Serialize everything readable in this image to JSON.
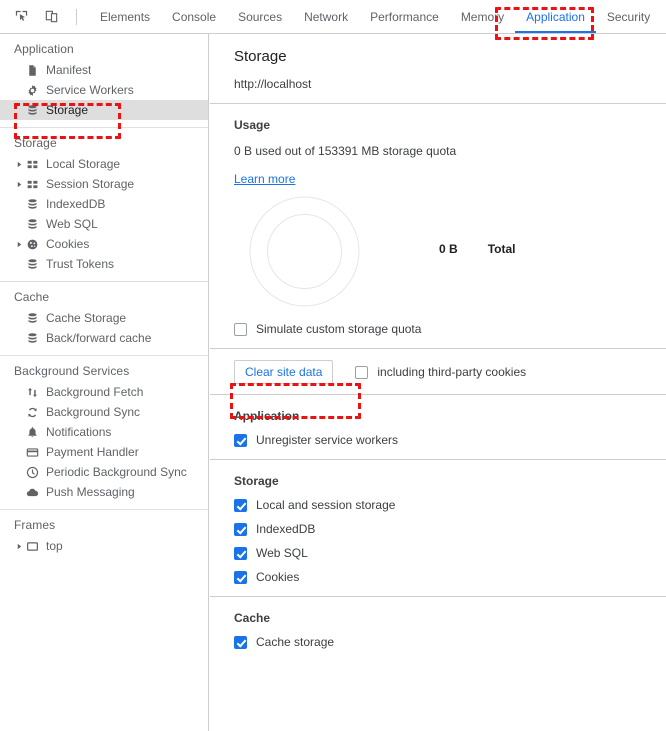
{
  "toolbar": {
    "inspect_icon": "inspect-cursor-icon",
    "device_icon": "device-toolbar-icon"
  },
  "tabs": [
    {
      "label": "Elements",
      "active": false
    },
    {
      "label": "Console",
      "active": false
    },
    {
      "label": "Sources",
      "active": false
    },
    {
      "label": "Network",
      "active": false
    },
    {
      "label": "Performance",
      "active": false
    },
    {
      "label": "Memory",
      "active": false
    },
    {
      "label": "Application",
      "active": true
    },
    {
      "label": "Security",
      "active": false
    }
  ],
  "sidebar": {
    "groups": [
      {
        "title": "Application",
        "items": [
          {
            "label": "Manifest",
            "icon": "document-icon",
            "arrow": false,
            "selected": false
          },
          {
            "label": "Service Workers",
            "icon": "gear-icon",
            "arrow": false,
            "selected": false
          },
          {
            "label": "Storage",
            "icon": "database-icon",
            "arrow": false,
            "selected": true
          }
        ]
      },
      {
        "title": "Storage",
        "items": [
          {
            "label": "Local Storage",
            "icon": "table-icon",
            "arrow": true,
            "selected": false
          },
          {
            "label": "Session Storage",
            "icon": "table-icon",
            "arrow": true,
            "selected": false
          },
          {
            "label": "IndexedDB",
            "icon": "database-icon",
            "arrow": false,
            "selected": false
          },
          {
            "label": "Web SQL",
            "icon": "database-icon",
            "arrow": false,
            "selected": false
          },
          {
            "label": "Cookies",
            "icon": "cookie-icon",
            "arrow": true,
            "selected": false
          },
          {
            "label": "Trust Tokens",
            "icon": "database-icon",
            "arrow": false,
            "selected": false
          }
        ]
      },
      {
        "title": "Cache",
        "items": [
          {
            "label": "Cache Storage",
            "icon": "database-icon",
            "arrow": false,
            "selected": false
          },
          {
            "label": "Back/forward cache",
            "icon": "database-icon",
            "arrow": false,
            "selected": false
          }
        ]
      },
      {
        "title": "Background Services",
        "items": [
          {
            "label": "Background Fetch",
            "icon": "arrows-updown-icon",
            "arrow": false,
            "selected": false
          },
          {
            "label": "Background Sync",
            "icon": "sync-icon",
            "arrow": false,
            "selected": false
          },
          {
            "label": "Notifications",
            "icon": "bell-icon",
            "arrow": false,
            "selected": false
          },
          {
            "label": "Payment Handler",
            "icon": "credit-card-icon",
            "arrow": false,
            "selected": false
          },
          {
            "label": "Periodic Background Sync",
            "icon": "clock-icon",
            "arrow": false,
            "selected": false
          },
          {
            "label": "Push Messaging",
            "icon": "cloud-icon",
            "arrow": false,
            "selected": false
          }
        ]
      },
      {
        "title": "Frames",
        "items": [
          {
            "label": "top",
            "icon": "frame-icon",
            "arrow": true,
            "selected": false
          }
        ]
      }
    ]
  },
  "panel": {
    "title": "Storage",
    "origin": "http://localhost",
    "usage": {
      "heading": "Usage",
      "text": "0 B used out of 153391 MB storage quota",
      "learn_more": "Learn more",
      "simulate_quota_label": "Simulate custom storage quota",
      "simulate_quota_checked": false
    },
    "clear": {
      "button_label": "Clear site data",
      "third_party_label": "including third-party cookies",
      "third_party_checked": false
    },
    "groups": [
      {
        "title": "Application",
        "items": [
          {
            "label": "Unregister service workers",
            "checked": true
          }
        ]
      },
      {
        "title": "Storage",
        "items": [
          {
            "label": "Local and session storage",
            "checked": true
          },
          {
            "label": "IndexedDB",
            "checked": true
          },
          {
            "label": "Web SQL",
            "checked": true
          },
          {
            "label": "Cookies",
            "checked": true
          }
        ]
      },
      {
        "title": "Cache",
        "items": [
          {
            "label": "Cache storage",
            "checked": true
          }
        ]
      }
    ]
  },
  "chart_data": {
    "type": "pie",
    "title": "Storage usage breakdown",
    "categories": [
      "Total"
    ],
    "values": [
      0
    ],
    "value_labels": [
      "0 B"
    ],
    "legend": [
      {
        "value": "0 B",
        "name": "Total"
      }
    ],
    "total_bytes": 0,
    "quota_mb": 153391,
    "legend_position": "right",
    "empty": true
  },
  "colors": {
    "accent": "#1a73e8",
    "annotation": "#ee1111",
    "text": "#3c4043",
    "muted": "#5f6368",
    "border": "#cdcdcd",
    "selected_bg": "#dedede"
  }
}
